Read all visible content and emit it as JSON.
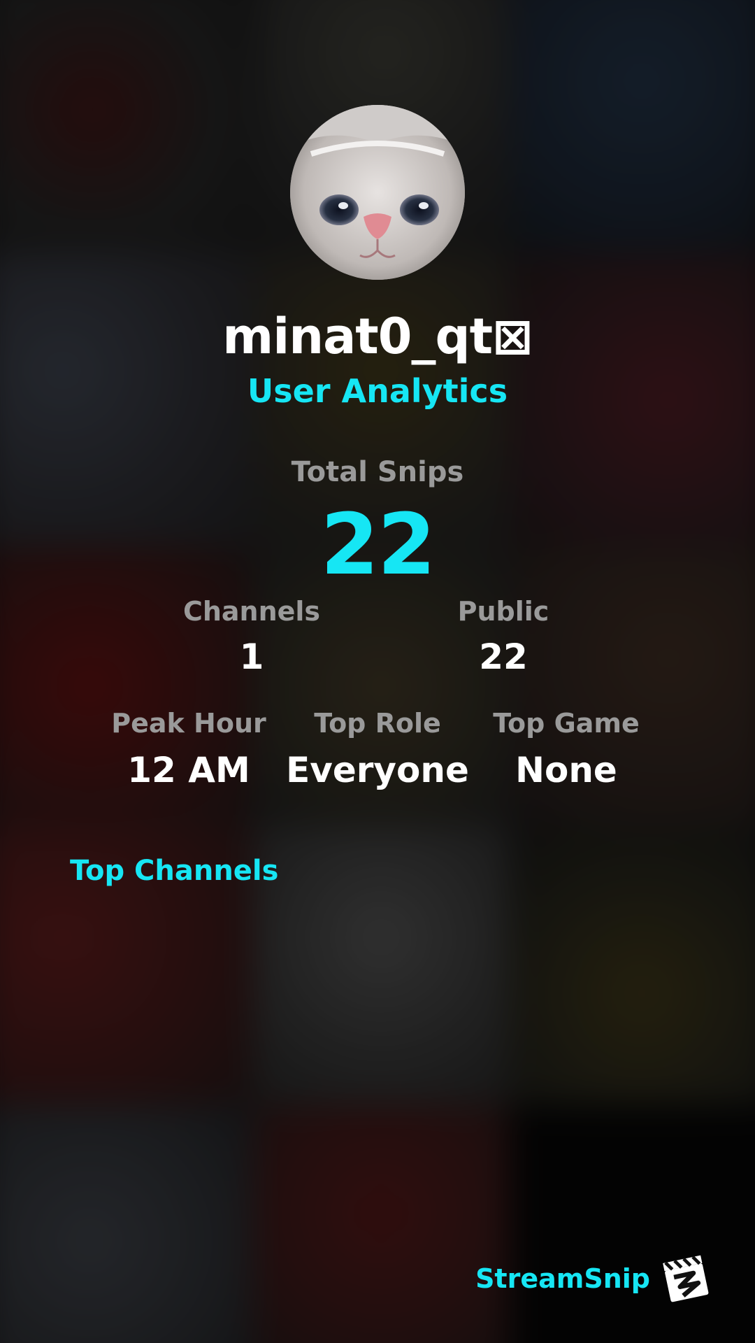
{
  "profile": {
    "username": "minat0_qt⊠",
    "subtitle": "User Analytics"
  },
  "stats": {
    "total_snips": {
      "label": "Total Snips",
      "value": "22"
    },
    "channels": {
      "label": "Channels",
      "value": "1"
    },
    "public": {
      "label": "Public",
      "value": "22"
    },
    "peak_hour": {
      "label": "Peak Hour",
      "value": "12 AM"
    },
    "top_role": {
      "label": "Top Role",
      "value": "Everyone"
    },
    "top_game": {
      "label": "Top Game",
      "value": "None"
    }
  },
  "sections": {
    "top_channels_heading": "Top Channels"
  },
  "brand": {
    "name": "StreamSnip",
    "logo_icon": "clapperboard-icon"
  },
  "colors": {
    "accent": "#16e6f4",
    "label": "#9a9a9a",
    "value": "#ffffff"
  }
}
